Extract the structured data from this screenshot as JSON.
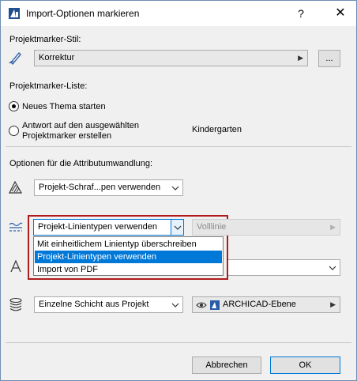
{
  "window": {
    "title": "Import-Optionen markieren",
    "help_label": "?",
    "close_label": "✕"
  },
  "style_section": {
    "heading": "Projektmarker-Stil:",
    "style_value": "Korrektur",
    "browse_label": "..."
  },
  "list_section": {
    "heading": "Projektmarker-Liste:",
    "option_new": "Neues Thema starten",
    "option_reply_line1": "Antwort auf den ausgewählten",
    "option_reply_line2": "Projektmarker erstellen",
    "reply_target": "Kindergarten"
  },
  "attributes_section": {
    "heading": "Optionen für die Attributumwandlung:",
    "fill_value": "Projekt-Schraf...pen verwenden",
    "linetype_value": "Projekt-Linientypen verwenden",
    "linetype_secondary": "Volllinie",
    "linetype_options": [
      "Mit einheitlichem Linientyp überschreiben",
      "Projekt-Linientypen verwenden",
      "Import von PDF"
    ],
    "linetype_selected_index": 1,
    "layer_value": "Einzelne Schicht aus Projekt",
    "layer_target": "ARCHICAD-Ebene"
  },
  "footer": {
    "cancel_label": "Abbrechen",
    "ok_label": "OK"
  },
  "colors": {
    "selection": "#0078d7",
    "highlight_frame": "#b01c1c",
    "layer_icon": "#2a5ca8"
  },
  "icons": [
    "archicad-app-icon",
    "pen-icon",
    "fill-hatch-icon",
    "linetype-icon",
    "font-icon",
    "layers-icon",
    "eye-icon",
    "layer-icon"
  ]
}
